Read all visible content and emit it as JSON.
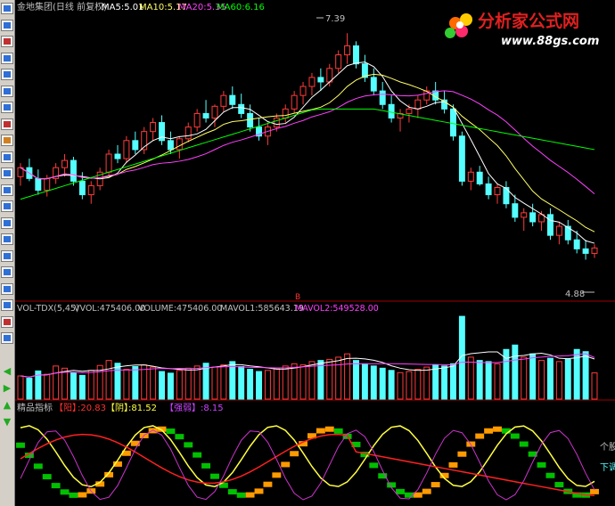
{
  "toolbar": {
    "buttons": [
      {
        "icon": "pointer-icon",
        "color": "#2f6fd6"
      },
      {
        "icon": "crosshair-icon",
        "color": "#2f6fd6"
      },
      {
        "icon": "line-chart-icon",
        "color": "#c03030"
      },
      {
        "icon": "candlestick-icon",
        "color": "#2f6fd6"
      },
      {
        "icon": "bar-chart-icon",
        "color": "#2f6fd6"
      },
      {
        "icon": "table-icon",
        "color": "#2f6fd6"
      },
      {
        "icon": "list-icon",
        "color": "#2f6fd6"
      },
      {
        "icon": "news-icon",
        "color": "#c03030"
      },
      {
        "icon": "book-icon",
        "color": "#d08020"
      },
      {
        "icon": "f10-info-icon",
        "color": "#2f6fd6"
      },
      {
        "icon": "people-icon",
        "color": "#2f6fd6"
      },
      {
        "icon": "globe-icon",
        "color": "#2f6fd6"
      },
      {
        "icon": "window-icon",
        "color": "#2f6fd6"
      },
      {
        "icon": "grid-icon",
        "color": "#2f6fd6"
      },
      {
        "icon": "indicator-icon",
        "color": "#2f6fd6"
      },
      {
        "icon": "compare-icon",
        "color": "#2f6fd6"
      },
      {
        "icon": "monitor-icon",
        "color": "#2f6fd6"
      },
      {
        "icon": "stats-icon",
        "color": "#2f6fd6"
      },
      {
        "icon": "zoom-icon",
        "color": "#2f6fd6"
      },
      {
        "icon": "alert-icon",
        "color": "#c03030"
      },
      {
        "icon": "settings-icon",
        "color": "#2f6fd6"
      }
    ],
    "arrows": [
      {
        "icon": "move-left-icon",
        "color": "#22aa22"
      },
      {
        "icon": "move-right-icon",
        "color": "#22aa22"
      },
      {
        "icon": "move-up-icon",
        "color": "#22aa22"
      },
      {
        "icon": "move-down-icon",
        "color": "#22aa22"
      }
    ]
  },
  "logo": {
    "text": "分析家公式网",
    "url": "www.88gs.com",
    "color": "#e02020",
    "url_color": "#ffffff"
  },
  "colors": {
    "up": "#ff3b3b",
    "down": "#55ffff",
    "ma5": "#ffffff",
    "ma10": "#ffff66",
    "ma20": "#ff40ff",
    "ma60": "#00ff00",
    "text": "#c0c0c0",
    "yellow": "#ffff40",
    "orange": "#ff9a00",
    "green": "#00c000",
    "red": "#ff2020",
    "magenta": "#cc33cc"
  },
  "price_panel": {
    "title": "金地集团(日线 前复权)",
    "ma_labels": [
      {
        "text": "MA5:5.01",
        "color": "#ffffff"
      },
      {
        "text": "MA10:5.17",
        "color": "#ffff66"
      },
      {
        "text": "MA20:5.35",
        "color": "#ff40ff"
      },
      {
        "text": "MA60:6.16",
        "color": "#00ff00"
      }
    ],
    "high_label": "7.39",
    "low_label": "4.88",
    "flag_label": "B"
  },
  "volume_panel": {
    "labels": [
      {
        "text": "VOL-TDX(5,45)",
        "color": "#c0c0c0"
      },
      {
        "text": "VVOL:475406.00",
        "color": "#c0c0c0"
      },
      {
        "text": "VOLUME:475406.00",
        "color": "#c0c0c0"
      },
      {
        "text": "MAVOL1:585643.19",
        "color": "#c0c0c0"
      },
      {
        "text": "MAVOL2:549528.00",
        "color": "#ff40ff"
      }
    ]
  },
  "indicator_panel": {
    "name": "精品指标",
    "labels": [
      {
        "text": "【阳】",
        "color": "#ff3030"
      },
      {
        "text": ":20.83",
        "color": "#ff3030"
      },
      {
        "text": "【阴】",
        "color": "#ffff40"
      },
      {
        "text": ":81.52",
        "color": "#ffff40"
      },
      {
        "text": "【强弱】",
        "color": "#cc44ff"
      },
      {
        "text": ":8.15",
        "color": "#cc44ff"
      }
    ],
    "right_labels": [
      {
        "text": "个股",
        "color": "#c0c0c0"
      },
      {
        "text": "下调",
        "color": "#55ffff"
      }
    ]
  },
  "chart_data": {
    "type": "candlestick",
    "security": "金地集团",
    "period": "日线 前复权",
    "price_range": [
      4.5,
      7.6
    ],
    "highest": 7.39,
    "lowest": 4.88,
    "ohlc": [
      [
        5.8,
        5.95,
        5.7,
        5.9
      ],
      [
        5.9,
        6.0,
        5.75,
        5.78
      ],
      [
        5.78,
        5.88,
        5.6,
        5.65
      ],
      [
        5.65,
        5.82,
        5.58,
        5.78
      ],
      [
        5.78,
        5.95,
        5.72,
        5.9
      ],
      [
        5.9,
        6.05,
        5.8,
        5.98
      ],
      [
        5.98,
        6.02,
        5.7,
        5.75
      ],
      [
        5.75,
        5.85,
        5.55,
        5.6
      ],
      [
        5.6,
        5.75,
        5.5,
        5.7
      ],
      [
        5.7,
        5.9,
        5.65,
        5.85
      ],
      [
        5.85,
        6.1,
        5.8,
        6.05
      ],
      [
        6.05,
        6.15,
        5.95,
        6.0
      ],
      [
        6.0,
        6.25,
        5.95,
        6.2
      ],
      [
        6.2,
        6.3,
        6.05,
        6.1
      ],
      [
        6.1,
        6.35,
        6.05,
        6.3
      ],
      [
        6.3,
        6.45,
        6.2,
        6.4
      ],
      [
        6.4,
        6.48,
        6.15,
        6.2
      ],
      [
        6.2,
        6.3,
        6.05,
        6.1
      ],
      [
        6.1,
        6.25,
        6.0,
        6.22
      ],
      [
        6.22,
        6.4,
        6.18,
        6.35
      ],
      [
        6.35,
        6.55,
        6.3,
        6.5
      ],
      [
        6.5,
        6.65,
        6.4,
        6.45
      ],
      [
        6.45,
        6.6,
        6.35,
        6.58
      ],
      [
        6.58,
        6.75,
        6.52,
        6.7
      ],
      [
        6.7,
        6.8,
        6.55,
        6.6
      ],
      [
        6.6,
        6.72,
        6.45,
        6.5
      ],
      [
        6.5,
        6.6,
        6.3,
        6.35
      ],
      [
        6.35,
        6.45,
        6.2,
        6.25
      ],
      [
        6.25,
        6.4,
        6.15,
        6.35
      ],
      [
        6.35,
        6.5,
        6.3,
        6.45
      ],
      [
        6.45,
        6.6,
        6.4,
        6.55
      ],
      [
        6.55,
        6.75,
        6.5,
        6.7
      ],
      [
        6.7,
        6.85,
        6.6,
        6.8
      ],
      [
        6.8,
        6.95,
        6.7,
        6.9
      ],
      [
        6.9,
        7.0,
        6.75,
        6.85
      ],
      [
        6.85,
        7.05,
        6.8,
        7.0
      ],
      [
        7.0,
        7.2,
        6.95,
        7.15
      ],
      [
        7.15,
        7.39,
        7.05,
        7.25
      ],
      [
        7.25,
        7.3,
        7.0,
        7.05
      ],
      [
        7.05,
        7.15,
        6.85,
        6.9
      ],
      [
        6.9,
        7.0,
        6.7,
        6.75
      ],
      [
        6.75,
        6.85,
        6.55,
        6.6
      ],
      [
        6.6,
        6.7,
        6.4,
        6.45
      ],
      [
        6.45,
        6.55,
        6.3,
        6.5
      ],
      [
        6.5,
        6.6,
        6.4,
        6.55
      ],
      [
        6.55,
        6.7,
        6.45,
        6.65
      ],
      [
        6.65,
        6.8,
        6.6,
        6.75
      ],
      [
        6.75,
        6.85,
        6.6,
        6.65
      ],
      [
        6.65,
        6.75,
        6.5,
        6.55
      ],
      [
        6.55,
        6.6,
        6.2,
        6.25
      ],
      [
        6.25,
        6.3,
        5.7,
        5.75
      ],
      [
        5.75,
        5.9,
        5.65,
        5.85
      ],
      [
        5.85,
        5.92,
        5.7,
        5.72
      ],
      [
        5.72,
        5.8,
        5.55,
        5.6
      ],
      [
        5.6,
        5.72,
        5.5,
        5.68
      ],
      [
        5.68,
        5.75,
        5.45,
        5.5
      ],
      [
        5.5,
        5.6,
        5.3,
        5.35
      ],
      [
        5.35,
        5.45,
        5.2,
        5.4
      ],
      [
        5.4,
        5.5,
        5.25,
        5.3
      ],
      [
        5.3,
        5.42,
        5.2,
        5.38
      ],
      [
        5.38,
        5.45,
        5.1,
        5.15
      ],
      [
        5.15,
        5.3,
        5.05,
        5.25
      ],
      [
        5.25,
        5.32,
        5.05,
        5.1
      ],
      [
        5.1,
        5.2,
        4.95,
        5.0
      ],
      [
        5.0,
        5.1,
        4.88,
        4.95
      ],
      [
        4.95,
        5.05,
        4.9,
        5.01
      ]
    ],
    "ma_series": [
      {
        "name": "MA5",
        "last": 5.01
      },
      {
        "name": "MA10",
        "last": 5.17
      },
      {
        "name": "MA20",
        "last": 5.35
      },
      {
        "name": "MA60",
        "last": 6.16
      }
    ],
    "volume": {
      "indicator": "VOL-TDX(5,45)",
      "vvol": 475406.0,
      "volume": 475406.0,
      "mavol1": 585643.19,
      "mavol2": 549528.0,
      "values": [
        420,
        380,
        510,
        450,
        600,
        560,
        480,
        430,
        520,
        610,
        700,
        650,
        540,
        590,
        620,
        580,
        500,
        470,
        520,
        560,
        600,
        650,
        580,
        620,
        680,
        590,
        540,
        500,
        520,
        560,
        600,
        640,
        620,
        680,
        700,
        720,
        760,
        820,
        700,
        640,
        600,
        560,
        520,
        480,
        500,
        540,
        580,
        620,
        600,
        640,
        1500,
        760,
        700,
        680,
        640,
        900,
        980,
        760,
        820,
        700,
        740,
        680,
        720,
        900,
        860,
        475
      ]
    },
    "oscillator": {
      "name": "精品指标",
      "yang": 20.83,
      "yin": 81.52,
      "strength": 8.15
    }
  }
}
